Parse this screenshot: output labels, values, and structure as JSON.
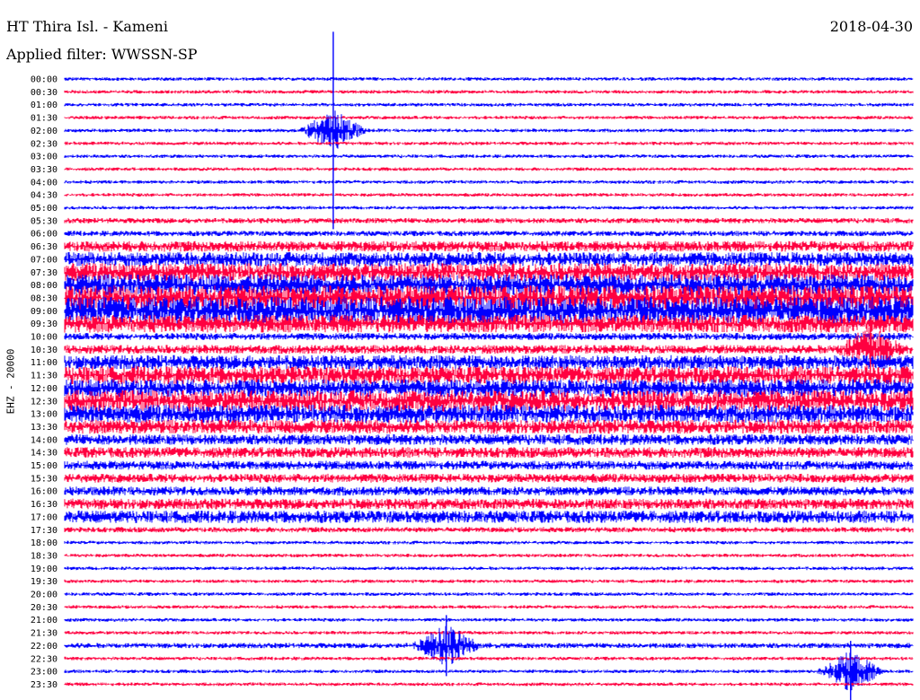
{
  "header": {
    "station": "HT Thira Isl. - Kameni",
    "date": "2018-04-30",
    "filter": "Applied filter: WWSSN-SP",
    "channel": "EHZ - 20000"
  },
  "colors": {
    "even_trace": "#0000ff",
    "odd_trace": "#ff0040",
    "background": "#ffffff"
  },
  "chart_data": {
    "type": "line",
    "title": "HT Thira Isl. - Kameni",
    "subtitle": "Applied filter: WWSSN-SP",
    "ylabel": "EHZ - 20000",
    "row_labels": [
      "00:00",
      "00:30",
      "01:00",
      "01:30",
      "02:00",
      "02:30",
      "03:00",
      "03:30",
      "04:00",
      "04:30",
      "05:00",
      "05:30",
      "06:00",
      "06:30",
      "07:00",
      "07:30",
      "08:00",
      "08:30",
      "09:00",
      "09:30",
      "10:00",
      "10:30",
      "11:00",
      "11:30",
      "12:00",
      "12:30",
      "13:00",
      "13:30",
      "14:00",
      "14:30",
      "15:00",
      "15:30",
      "16:00",
      "16:30",
      "17:00",
      "17:30",
      "18:00",
      "18:30",
      "19:00",
      "19:30",
      "20:00",
      "20:30",
      "21:00",
      "21:30",
      "22:00",
      "22:30",
      "23:00",
      "23:30"
    ],
    "minutes_per_row": 30,
    "noise_level": [
      2,
      2,
      2,
      2,
      2,
      2,
      2,
      2,
      2,
      2,
      2,
      3,
      3,
      6,
      8,
      10,
      12,
      14,
      16,
      10,
      4,
      5,
      8,
      10,
      10,
      12,
      10,
      8,
      6,
      6,
      5,
      5,
      5,
      6,
      7,
      3,
      2,
      2,
      2,
      2,
      2,
      2,
      2,
      2,
      3,
      2,
      2,
      2
    ],
    "events": [
      {
        "row": 4,
        "minute": 9.5,
        "label": "large spike"
      },
      {
        "row": 21,
        "minute": 28.5,
        "label": "spike"
      },
      {
        "row": 44,
        "minute": 13.5,
        "label": "burst"
      },
      {
        "row": 46,
        "minute": 27.8,
        "label": "burst"
      }
    ]
  }
}
